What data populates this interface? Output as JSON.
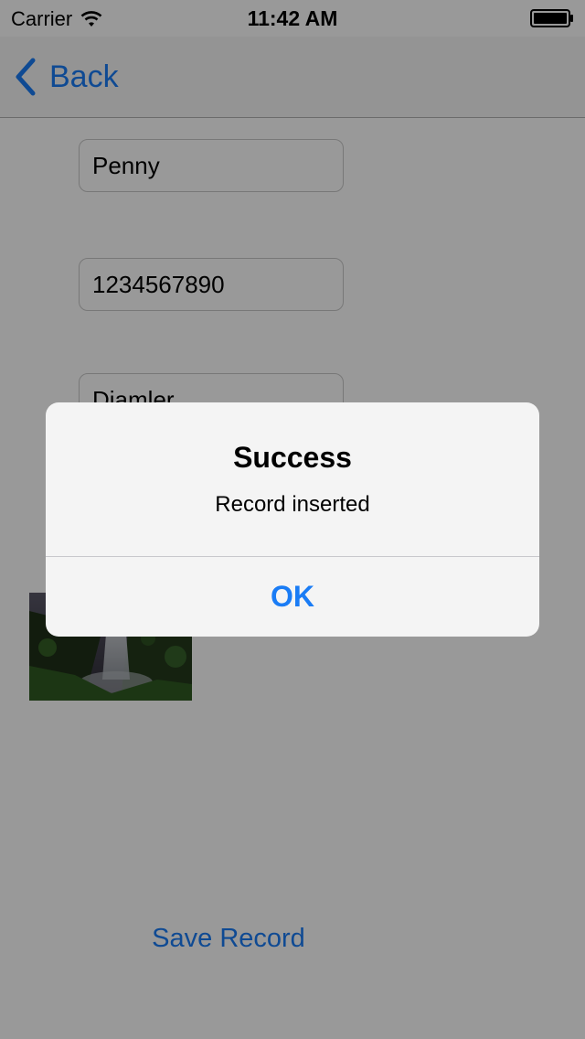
{
  "status_bar": {
    "carrier": "Carrier",
    "time": "11:42 AM"
  },
  "nav": {
    "back_label": "Back"
  },
  "form": {
    "name_value": "Penny",
    "phone_value": "1234567890",
    "company_value": "Diamler"
  },
  "save_button_label": "Save Record",
  "alert": {
    "title": "Success",
    "message": "Record inserted",
    "ok_label": "OK"
  },
  "colors": {
    "accent": "#1a7cf5"
  }
}
